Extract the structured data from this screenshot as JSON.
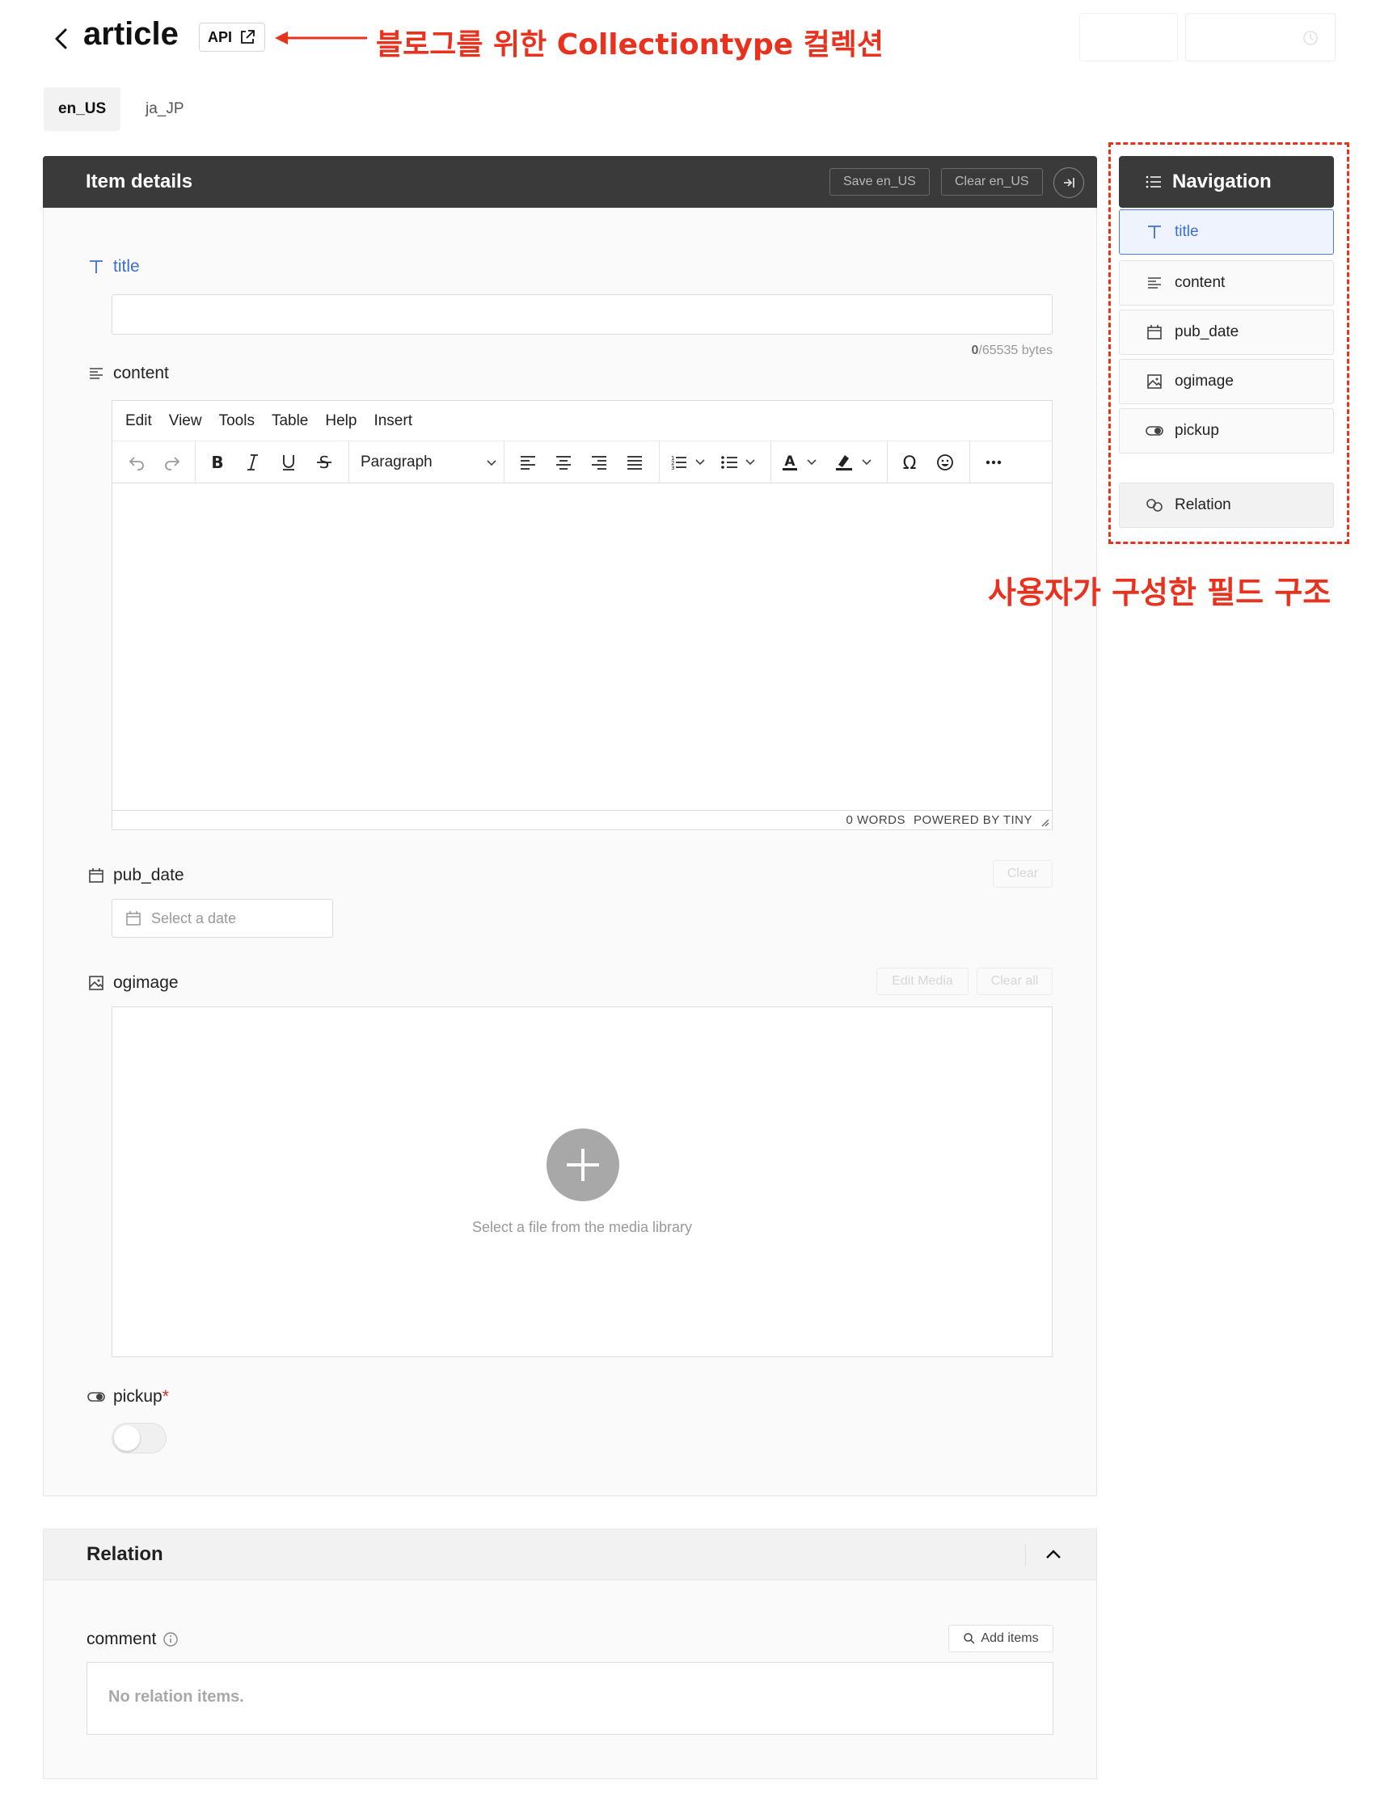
{
  "header": {
    "title": "article",
    "api_badge": "API"
  },
  "annotations": {
    "collection_note": "블로그를 위한 Collectiontype 컬렉션",
    "fields_note": "사용자가 구성한 필드 구조"
  },
  "locales": [
    "en_US",
    "ja_JP"
  ],
  "item_details": {
    "title": "Item details",
    "save_label": "Save en_US",
    "clear_label": "Clear en_US"
  },
  "fields": {
    "title": {
      "label": "title",
      "value": "",
      "bytes_used": "0",
      "bytes_limit": "/65535 bytes"
    },
    "content": {
      "label": "content",
      "menu": [
        "Edit",
        "View",
        "Tools",
        "Table",
        "Help",
        "Insert"
      ],
      "block_format": "Paragraph",
      "words": "0 WORDS",
      "powered_by": "POWERED BY TINY"
    },
    "pub_date": {
      "label": "pub_date",
      "clear_label": "Clear",
      "placeholder": "Select a date"
    },
    "ogimage": {
      "label": "ogimage",
      "edit_media_label": "Edit Media",
      "clear_all_label": "Clear all",
      "hint": "Select a file from the media library"
    },
    "pickup": {
      "label": "pickup",
      "required_mark": "*",
      "enabled": false
    }
  },
  "relation": {
    "title": "Relation",
    "comment_label": "comment",
    "add_items_label": "Add items",
    "empty_text": "No relation items."
  },
  "navigation": {
    "title": "Navigation",
    "items": [
      {
        "label": "title",
        "icon": "text-icon",
        "active": true
      },
      {
        "label": "content",
        "icon": "rich-text-icon",
        "active": false
      },
      {
        "label": "pub_date",
        "icon": "calendar-icon",
        "active": false
      },
      {
        "label": "ogimage",
        "icon": "image-icon",
        "active": false
      },
      {
        "label": "pickup",
        "icon": "toggle-icon",
        "active": false
      },
      {
        "label": "Relation",
        "icon": "link-icon",
        "active": false
      }
    ]
  },
  "colors": {
    "accent_blue": "#3b6fd6",
    "annotation_red": "#e8321e",
    "header_dark": "#3a3a3a"
  }
}
